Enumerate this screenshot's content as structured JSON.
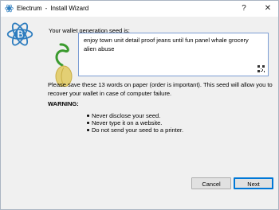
{
  "window": {
    "app_name": "Electrum",
    "separator": "-",
    "title": "Install Wizard",
    "help_label": "?",
    "close_label": "✕"
  },
  "seed": {
    "label": "Your wallet generation seed is:",
    "words": "enjoy town unit detail proof jeans until fun panel whale grocery alien abuse"
  },
  "info": {
    "text": "Please save these 13 words on paper (order is important). This seed will allow you to recover your wallet in case of computer failure."
  },
  "warning": {
    "title": "WARNING:",
    "items": [
      "Never disclose your seed.",
      "Never type it on a website.",
      "Do not send your seed to a printer."
    ]
  },
  "buttons": {
    "cancel": "Cancel",
    "next": "Next"
  },
  "icons": {
    "app": "electrum-logo-icon",
    "logo": "electrum-logo-icon",
    "seed": "seed-icon",
    "qr": "qr-code-icon"
  },
  "colors": {
    "accent": "#0078d7",
    "logo": "#2e7dbf",
    "seed_green": "#3a9a2e",
    "seed_yellow": "#e3cf74"
  }
}
